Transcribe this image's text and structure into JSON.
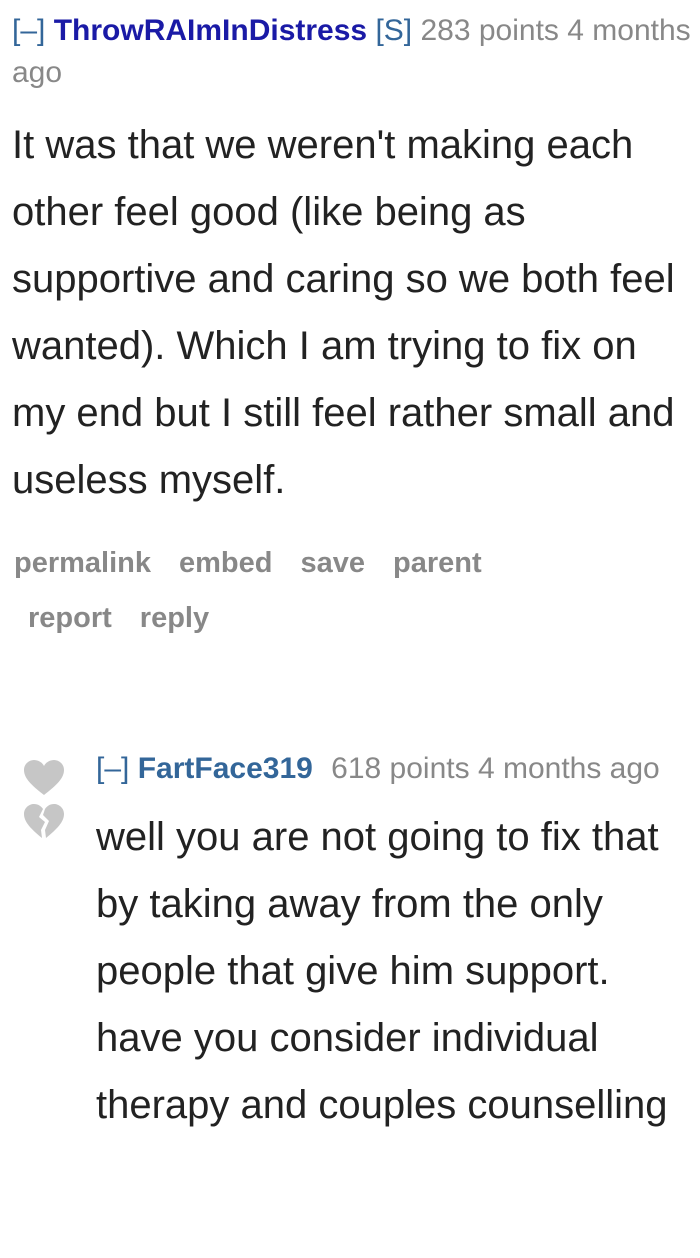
{
  "comments": [
    {
      "collapse": "[–]",
      "author": "ThrowRAImInDistress",
      "submitter_tag": "[S]",
      "points": "283 points",
      "time": "4 months ago",
      "body": "It was that we weren't making each other feel good (like being as supportive and caring so we both feel wanted). Which I am trying to fix on my end but I still feel rather small and useless myself.",
      "buttons": {
        "permalink": "permalink",
        "embed": "embed",
        "save": "save",
        "parent": "parent",
        "report": "report",
        "reply": "reply"
      }
    },
    {
      "collapse": "[–]",
      "author": "FartFace319",
      "points": "618 points",
      "time": "4 months ago",
      "body": "well you are not going to fix that by taking away from the only people that give him support. have you consider individual therapy and couples counselling",
      "vote_icons": {
        "up": "upvote-heart-icon",
        "down": "downvote-broken-heart-icon"
      }
    }
  ],
  "colors": {
    "author_link": "#1a1aa6",
    "link": "#336699",
    "meta": "#888888",
    "body_text": "#222222",
    "vote_icon": "#c6c6c6"
  }
}
